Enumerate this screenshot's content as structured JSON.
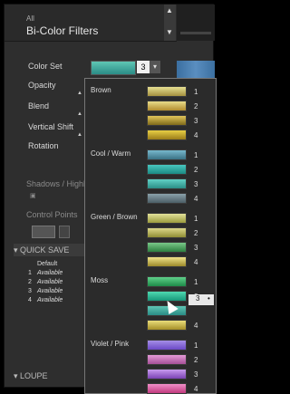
{
  "header": {
    "category": "All",
    "title": "Bi-Color Filters"
  },
  "controls": {
    "color_set": {
      "label": "Color Set",
      "value": "3"
    },
    "opacity": {
      "label": "Opacity"
    },
    "blend": {
      "label": "Blend"
    },
    "vertical_shift": {
      "label": "Vertical Shift"
    },
    "rotation": {
      "label": "Rotation"
    },
    "shadows": {
      "label": "Shadows / Highl"
    },
    "control_points": {
      "label": "Control Points"
    }
  },
  "dropdown": {
    "groups": [
      {
        "name": "Brown",
        "items": [
          {
            "n": "1",
            "c1": "#e6df92",
            "c2": "#a4913f"
          },
          {
            "n": "2",
            "c1": "#e8db8a",
            "c2": "#b38d2e"
          },
          {
            "n": "3",
            "c1": "#e0c55a",
            "c2": "#7f6a1a"
          },
          {
            "n": "4",
            "c1": "#e8cf44",
            "c2": "#9a7c1a"
          }
        ]
      },
      {
        "name": "Cool / Warm",
        "items": [
          {
            "n": "1",
            "c1": "#77b8cc",
            "c2": "#3a7184"
          },
          {
            "n": "2",
            "c1": "#49c7c0",
            "c2": "#1b8a83"
          },
          {
            "n": "3",
            "c1": "#61d1c6",
            "c2": "#2b8e86"
          },
          {
            "n": "4",
            "c1": "#8aa1aa",
            "c2": "#4c5e66"
          }
        ]
      },
      {
        "name": "Green / Brown",
        "items": [
          {
            "n": "1",
            "c1": "#e3e19a",
            "c2": "#9b9b3d"
          },
          {
            "n": "2",
            "c1": "#dcd88a",
            "c2": "#8f8d34"
          },
          {
            "n": "3",
            "c1": "#7ac888",
            "c2": "#2c7f3f"
          },
          {
            "n": "4",
            "c1": "#f0e48a",
            "c2": "#9c8a2a"
          }
        ]
      },
      {
        "name": "Moss",
        "items": [
          {
            "n": "1",
            "c1": "#5fd08a",
            "c2": "#1e8a48"
          },
          {
            "n": "2",
            "c1": "#4fd9b0",
            "c2": "#17977a"
          },
          {
            "n": "3",
            "c1": "#5fc6b4",
            "c2": "#2a8c86"
          },
          {
            "n": "4",
            "c1": "#e9dd7a",
            "c2": "#a58e28"
          }
        ]
      },
      {
        "name": "Violet / Pink",
        "items": [
          {
            "n": "1",
            "c1": "#a58ee6",
            "c2": "#6b48c6"
          },
          {
            "n": "2",
            "c1": "#e39ad7",
            "c2": "#a54f96"
          },
          {
            "n": "3",
            "c1": "#c89aee",
            "c2": "#7a43b4"
          },
          {
            "n": "4",
            "c1": "#f08fc8",
            "c2": "#c23a7e"
          }
        ]
      }
    ],
    "selected_group": "Moss",
    "selected_item": "3"
  },
  "quick_save": {
    "title": "QUICK SAVE",
    "column": "Default",
    "rows": [
      {
        "n": "1",
        "v": "Available"
      },
      {
        "n": "2",
        "v": "Available"
      },
      {
        "n": "3",
        "v": "Available"
      },
      {
        "n": "4",
        "v": "Available"
      }
    ]
  },
  "loupe": {
    "title": "LOUPE"
  }
}
